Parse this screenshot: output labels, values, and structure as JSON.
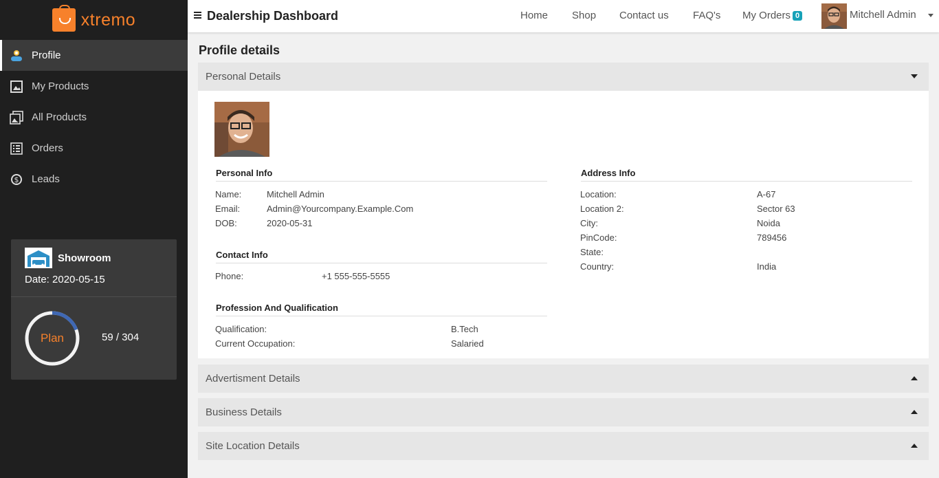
{
  "brand": {
    "name": "xtremo"
  },
  "sidebar": {
    "items": [
      {
        "label": "Profile",
        "icon": "profile-icon"
      },
      {
        "label": "My Products",
        "icon": "image-icon"
      },
      {
        "label": "All Products",
        "icon": "gallery-icon"
      },
      {
        "label": "Orders",
        "icon": "list-icon"
      },
      {
        "label": "Leads",
        "icon": "dollar-icon"
      }
    ]
  },
  "plan_card": {
    "title": "Showroom",
    "date_text": "Date: 2020-05-15",
    "plan_label": "Plan",
    "count_text": "59 / 304",
    "progress": 0.194
  },
  "topbar": {
    "title": "Dealership Dashboard",
    "links": {
      "home": "Home",
      "shop": "Shop",
      "contact": "Contact us",
      "faq": "FAQ's",
      "orders": "My Orders"
    },
    "orders_count": "0",
    "user_name": "Mitchell Admin"
  },
  "page": {
    "title": "Profile details"
  },
  "accordions": {
    "personal": "Personal Details",
    "advertisment": "Advertisment Details",
    "business": "Business Details",
    "site_location": "Site Location Details"
  },
  "personal_info": {
    "title": "Personal Info",
    "name_label": "Name:",
    "name": "Mitchell Admin",
    "email_label": "Email:",
    "email": "Admin@Yourcompany.Example.Com",
    "dob_label": "DOB:",
    "dob": "2020-05-31"
  },
  "contact_info": {
    "title": "Contact Info",
    "phone_label": "Phone:",
    "phone": "+1 555-555-5555"
  },
  "profession": {
    "title": "Profession And Qualification",
    "qualification_label": "Qualification:",
    "qualification": "B.Tech",
    "occupation_label": "Current Occupation:",
    "occupation": "Salaried"
  },
  "address_info": {
    "title": "Address Info",
    "location_label": "Location:",
    "location": "A-67",
    "location2_label": "Location 2:",
    "location2": "Sector 63",
    "city_label": "City:",
    "city": "Noida",
    "pincode_label": "PinCode:",
    "pincode": "789456",
    "state_label": "State:",
    "state": "",
    "country_label": "Country:",
    "country": "India"
  },
  "colors": {
    "accent": "#f7812b",
    "sidebar": "#1f1f1f",
    "badge": "#17a2b8",
    "ring": "#3f68b4"
  }
}
